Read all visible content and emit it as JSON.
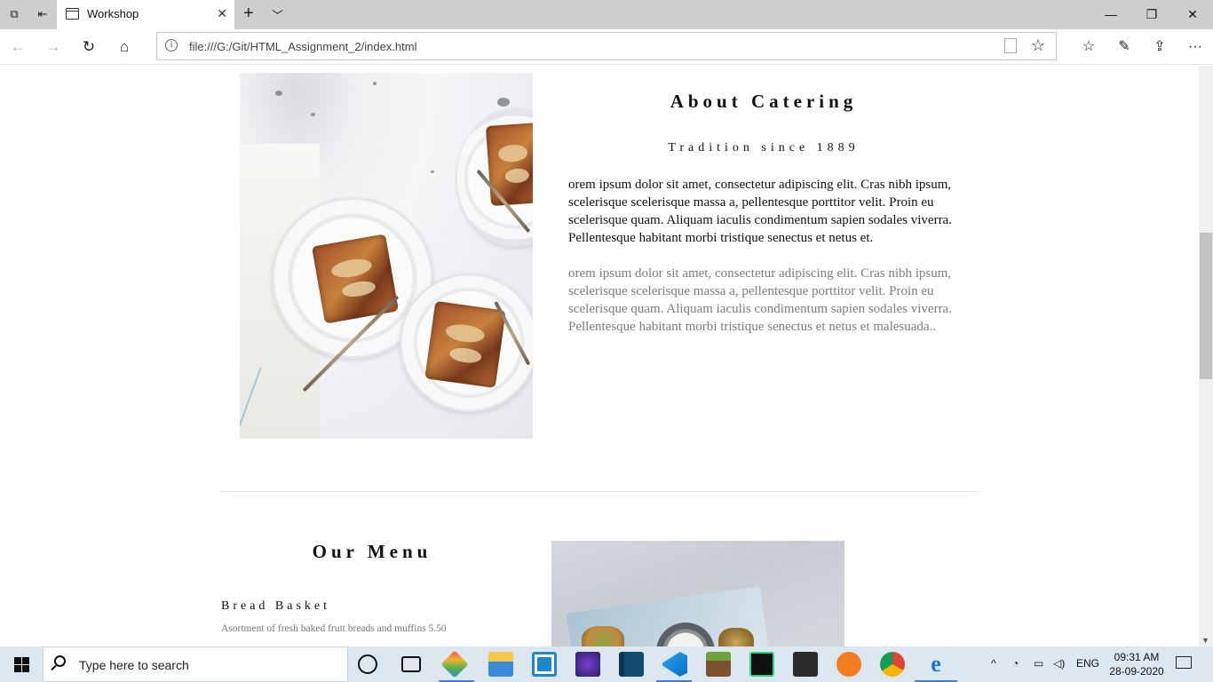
{
  "browser": {
    "tab_title": "Workshop",
    "url": "file:///G:/Git/HTML_Assignment_2/index.html"
  },
  "about": {
    "title": "About Catering",
    "subtitle": "Tradition since 1889",
    "paragraph1": "orem ipsum dolor sit amet, consectetur adipiscing elit. Cras nibh ipsum, scelerisque scelerisque massa a, pellentesque porttitor velit. Proin eu scelerisque quam. Aliquam iaculis condimentum sapien sodales viverra. Pellentesque habitant morbi tristique senectus et netus et.",
    "paragraph2": "orem ipsum dolor sit amet, consectetur adipiscing elit. Cras nibh ipsum, scelerisque scelerisque massa a, pellentesque porttitor velit. Proin eu scelerisque quam. Aliquam iaculis condimentum sapien sodales viverra. Pellentesque habitant morbi tristique senectus et netus et malesuada.."
  },
  "menu": {
    "title": "Our Menu",
    "items": [
      {
        "name": "Bread Basket",
        "description": "Asortment of fresh baked fruit breads and muffins 5.50"
      }
    ]
  },
  "taskbar": {
    "search_placeholder": "Type here to search",
    "language": "ENG",
    "time": "09:31 AM",
    "date": "28-09-2020"
  },
  "colors": {
    "taskbar_bg": "#dde7f0",
    "tab_strip_bg": "#cfcfcf",
    "body_text": "#111111",
    "muted_text": "#7d7d7d"
  }
}
